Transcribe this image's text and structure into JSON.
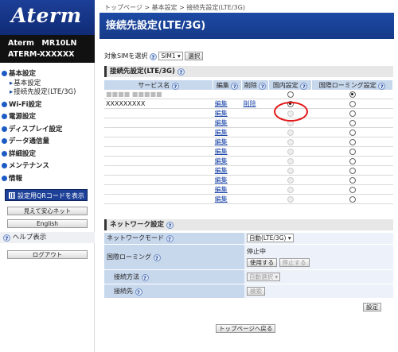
{
  "sidebar": {
    "logo": "Aterm",
    "model": "Aterm　MR10LN",
    "serial": "ATERM-XXXXXX",
    "menu": [
      {
        "label": "基本設定",
        "subs": [
          "基本設定",
          "接続先設定(LTE/3G)"
        ]
      },
      {
        "label": "Wi-Fi設定"
      },
      {
        "label": "電源設定"
      },
      {
        "label": "ディスプレイ設定"
      },
      {
        "label": "データ通信量"
      },
      {
        "label": "詳細設定"
      },
      {
        "label": "メンテナンス"
      },
      {
        "label": "情報"
      }
    ],
    "qr_button": "設定用QRコードを表示",
    "mieru_button": "見えて安心ネット",
    "language_button": "English",
    "help": "ヘルプ表示",
    "logout": "ログアウト"
  },
  "breadcrumb": "トップページ > 基本設定 > 接続先設定(LTE/3G)",
  "page_title": "接続先設定(LTE/3G)",
  "sim": {
    "label": "対象SIMを選択",
    "help": "?",
    "selected": "SIM1",
    "select_button": "選択"
  },
  "connection": {
    "section_title": "接続先設定(LTE/3G)",
    "headers": {
      "service": "サービス名",
      "edit": "編集",
      "delete": "削除",
      "domestic": "国内設定",
      "roaming": "国際ローミング設定"
    },
    "rows": [
      {
        "name": "■■■■ ■■■■■",
        "edit": "",
        "delete": "",
        "domestic": "off",
        "roaming": "on"
      },
      {
        "name": "XXXXXXXXX",
        "edit": "編集",
        "delete": "削除",
        "domestic": "on",
        "roaming": "off"
      },
      {
        "name": "",
        "edit": "編集",
        "delete": "",
        "domestic": "dis",
        "roaming": "off"
      },
      {
        "name": "",
        "edit": "編集",
        "delete": "",
        "domestic": "dis",
        "roaming": "off"
      },
      {
        "name": "",
        "edit": "編集",
        "delete": "",
        "domestic": "dis",
        "roaming": "off"
      },
      {
        "name": "",
        "edit": "編集",
        "delete": "",
        "domestic": "dis",
        "roaming": "off"
      },
      {
        "name": "",
        "edit": "編集",
        "delete": "",
        "domestic": "dis",
        "roaming": "off"
      },
      {
        "name": "",
        "edit": "編集",
        "delete": "",
        "domestic": "dis",
        "roaming": "off"
      },
      {
        "name": "",
        "edit": "編集",
        "delete": "",
        "domestic": "dis",
        "roaming": "off"
      },
      {
        "name": "",
        "edit": "編集",
        "delete": "",
        "domestic": "dis",
        "roaming": "off"
      },
      {
        "name": "",
        "edit": "編集",
        "delete": "",
        "domestic": "dis",
        "roaming": "off"
      },
      {
        "name": "",
        "edit": "編集",
        "delete": "",
        "domestic": "dis",
        "roaming": "off"
      }
    ]
  },
  "network": {
    "section_title": "ネットワーク設定",
    "mode_label": "ネットワークモード",
    "mode_value": "自動(LTE/3G)",
    "roaming_label": "国際ローミング",
    "roaming_status": "停止中",
    "use_button": "使用する",
    "stop_button": "停止する",
    "method_label": "接続方法",
    "method_value": "自動選択",
    "dest_label": "接続先",
    "search_button": "検索",
    "set_button": "設定"
  },
  "back_top": "トップページへ戻る",
  "colors": {
    "header_blue": "#1d4aa5",
    "table_header": "#c7d7ec",
    "highlight": "#e41515"
  }
}
